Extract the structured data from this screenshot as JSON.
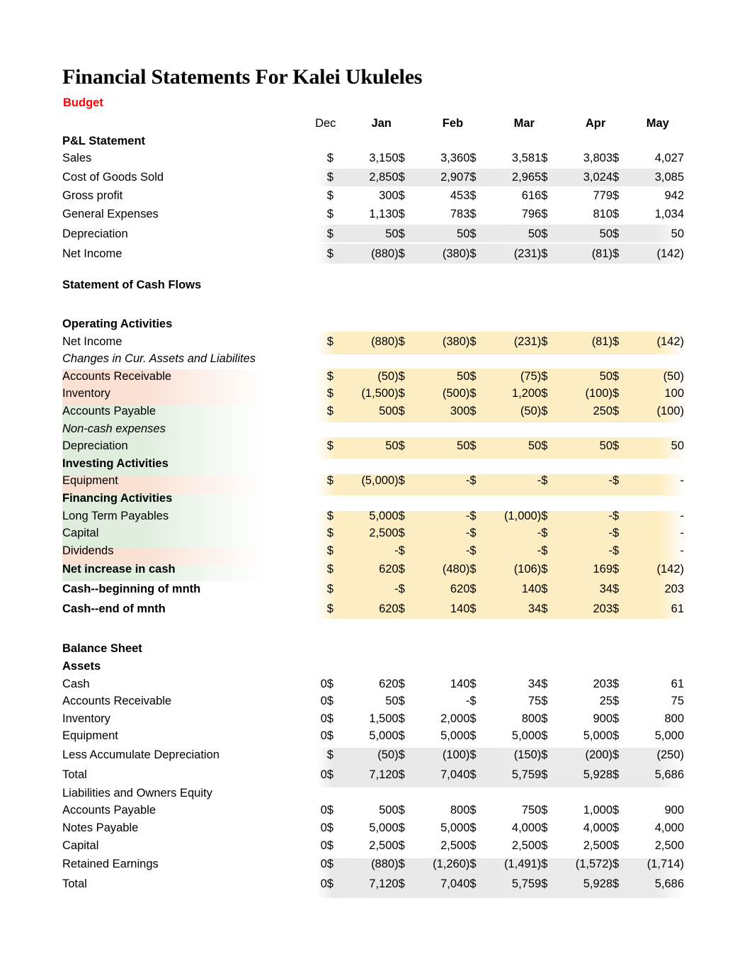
{
  "document": {
    "title": "Financial Statements For Kalei Ukuleles",
    "budget_label": "Budget"
  },
  "colors": {
    "budget_text": "#ff0000",
    "highlight_yellow": "#fdecbe",
    "highlight_gray": "#e4e4e4",
    "highlight_pink": "#f9ddd1",
    "highlight_green": "#ddecdb"
  },
  "columns": {
    "dec": "Dec",
    "months": [
      "Jan",
      "Feb",
      "Mar",
      "Apr",
      "May"
    ],
    "currency_symbol": "$",
    "zero_glyph": "-"
  },
  "sections": {
    "pl": {
      "heading": "P&L Statement",
      "rows": [
        {
          "label": "Sales",
          "values": [
            "3,150",
            "3,360",
            "3,581",
            "3,803",
            "4,027"
          ]
        },
        {
          "label": "Cost of Goods Sold",
          "values": [
            "2,850",
            "2,907",
            "2,965",
            "3,024",
            "3,085"
          ]
        },
        {
          "label": "Gross profit",
          "values": [
            "300",
            "453",
            "616",
            "779",
            "942"
          ]
        },
        {
          "label": "General Expenses",
          "values": [
            "1,130",
            "783",
            "796",
            "810",
            "1,034"
          ]
        },
        {
          "label": "Depreciation",
          "values": [
            "50",
            "50",
            "50",
            "50",
            "50"
          ]
        },
        {
          "label": "Net Income",
          "values": [
            "(880)",
            "(380)",
            "(231)",
            "(81)",
            "(142)"
          ]
        }
      ]
    },
    "cash_flows": {
      "heading": "Statement of Cash Flows",
      "operating_heading": "Operating Activities",
      "net_income": {
        "label": "Net Income",
        "values": [
          "(880)",
          "(380)",
          "(231)",
          "(81)",
          "(142)"
        ]
      },
      "changes_note": "Changes in Cur. Assets and Liabilites",
      "changes_rows": [
        {
          "label": "Accounts Receivable",
          "values": [
            "(50)",
            "50",
            "(75)",
            "50",
            "(50)"
          ]
        },
        {
          "label": "Inventory",
          "values": [
            "(1,500)",
            "(500)",
            "1,200",
            "(100)",
            "100"
          ]
        },
        {
          "label": "Accounts Payable",
          "values": [
            "500",
            "300",
            "(50)",
            "250",
            "(100)"
          ]
        }
      ],
      "noncash_note": "Non-cash expenses",
      "noncash_rows": [
        {
          "label": "Depreciation",
          "values": [
            "50",
            "50",
            "50",
            "50",
            "50"
          ]
        }
      ],
      "investing_heading": "Investing Activities",
      "investing_rows": [
        {
          "label": "Equipment",
          "values": [
            "(5,000)",
            "-",
            "-",
            "-",
            "-"
          ]
        }
      ],
      "financing_heading": "Financing Activities",
      "financing_rows": [
        {
          "label": "Long Term Payables",
          "values": [
            "5,000",
            "-",
            "(1,000)",
            "-",
            "-"
          ]
        },
        {
          "label": "Capital",
          "values": [
            "2,500",
            "-",
            "-",
            "-",
            "-"
          ]
        },
        {
          "label": "Dividends",
          "values": [
            "-",
            "-",
            "-",
            "-",
            "-"
          ]
        }
      ],
      "totals": [
        {
          "label": "Net increase in cash",
          "values": [
            "620",
            "(480)",
            "(106)",
            "169",
            "(142)"
          ]
        },
        {
          "label": "Cash--beginning of mnth",
          "values": [
            "-",
            "620",
            "140",
            "34",
            "203"
          ]
        },
        {
          "label": "Cash--end of mnth",
          "values": [
            "620",
            "140",
            "34",
            "203",
            "61"
          ]
        }
      ]
    },
    "balance_sheet": {
      "heading": "Balance Sheet",
      "assets_heading": "Assets",
      "asset_rows": [
        {
          "label": "Cash",
          "dec": "0",
          "values": [
            "620",
            "140",
            "34",
            "203",
            "61"
          ]
        },
        {
          "label": "Accounts Receivable",
          "dec": "0",
          "values": [
            "50",
            "-",
            "75",
            "25",
            "75"
          ]
        },
        {
          "label": "Inventory",
          "dec": "0",
          "values": [
            "1,500",
            "2,000",
            "800",
            "900",
            "800"
          ]
        },
        {
          "label": "Equipment",
          "dec": "0",
          "values": [
            "5,000",
            "5,000",
            "5,000",
            "5,000",
            "5,000"
          ]
        },
        {
          "label": "Less Accumulate Depreciation",
          "dec": "",
          "values": [
            "(50)",
            "(100)",
            "(150)",
            "(200)",
            "(250)"
          ]
        },
        {
          "label": "Total",
          "dec": "0",
          "values": [
            "7,120",
            "7,040",
            "5,759",
            "5,928",
            "5,686"
          ]
        }
      ],
      "liabilities_heading": "Liabilities and Owners Equity",
      "liability_rows": [
        {
          "label": "Accounts Payable",
          "dec": "0",
          "values": [
            "500",
            "800",
            "750",
            "1,000",
            "900"
          ]
        },
        {
          "label": "Notes Payable",
          "dec": "0",
          "values": [
            "5,000",
            "5,000",
            "4,000",
            "4,000",
            "4,000"
          ]
        },
        {
          "label": "Capital",
          "dec": "0",
          "values": [
            "2,500",
            "2,500",
            "2,500",
            "2,500",
            "2,500"
          ]
        },
        {
          "label": "Retained Earnings",
          "dec": "0",
          "values": [
            "(880)",
            "(1,260)",
            "(1,491)",
            "(1,572)",
            "(1,714)"
          ]
        },
        {
          "label": "Total",
          "dec": "0",
          "values": [
            "7,120",
            "7,040",
            "5,759",
            "5,928",
            "5,686"
          ]
        }
      ]
    }
  }
}
